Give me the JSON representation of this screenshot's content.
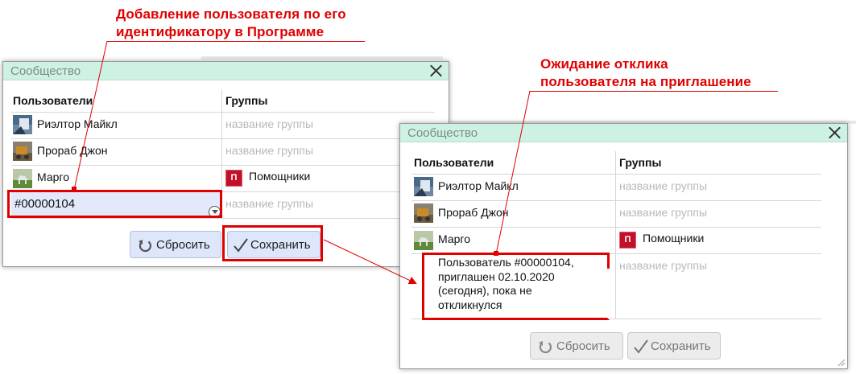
{
  "annotations": {
    "add_user_line1": "Добавление пользователя по его",
    "add_user_line2": "идентификатору в Программе",
    "await_line1": "Ожидание отклика",
    "await_line2": "пользователя на приглашение"
  },
  "dialog_left": {
    "title": "Сообщество",
    "columns": {
      "users": "Пользователи",
      "groups": "Группы"
    },
    "rows": [
      {
        "user": "Риэлтор Майкл",
        "group_placeholder": "название группы"
      },
      {
        "user": "Прораб Джон",
        "group_placeholder": "название группы"
      },
      {
        "user": "Марго",
        "group": "Помощники",
        "group_badge": "П"
      }
    ],
    "new_user_input": {
      "value": "#00000104",
      "group_placeholder": "название группы"
    },
    "buttons": {
      "reset": "Сбросить",
      "save": "Сохранить"
    }
  },
  "dialog_right": {
    "title": "Сообщество",
    "columns": {
      "users": "Пользователи",
      "groups": "Группы"
    },
    "rows": [
      {
        "user": "Риэлтор Майкл",
        "group_placeholder": "название группы"
      },
      {
        "user": "Прораб Джон",
        "group_placeholder": "название группы"
      },
      {
        "user": "Марго",
        "group": "Помощники",
        "group_badge": "П"
      }
    ],
    "pending": {
      "line1": "Пользователь #00000104,",
      "line2": "приглашен 02.10.2020",
      "line3": "(сегодня), пока не",
      "line4": "откликнулся",
      "group_placeholder": "название группы"
    },
    "buttons": {
      "reset": "Сбросить",
      "save": "Сохранить"
    }
  },
  "colors": {
    "accent": "#e00000",
    "header": "#cdf2e3",
    "button": "#dde6fa",
    "badge": "#c0102a"
  }
}
